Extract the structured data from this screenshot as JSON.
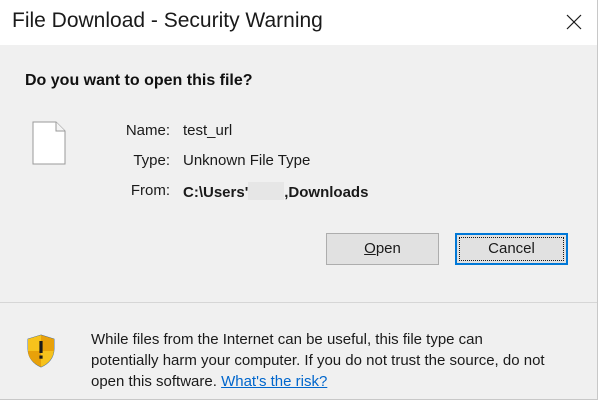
{
  "window": {
    "title": "File Download - Security Warning"
  },
  "prompt": {
    "heading": "Do you want to open this file?"
  },
  "file_info": {
    "name_label": "Name:",
    "name_value": "test_url",
    "type_label": "Type:",
    "type_value": "Unknown File Type",
    "from_label": "From:",
    "from_value_prefix": "C:\\Users'",
    "from_value_suffix": ",Downloads"
  },
  "buttons": {
    "open_label_mnemonic": "O",
    "open_label_rest": "pen",
    "cancel_label": "Cancel"
  },
  "warning": {
    "line1": "While files from the Internet can be useful, this file type can",
    "line2": "potentially harm your computer. If you do not trust the source, do not",
    "line3_text": "open this software. ",
    "link_text": "What's the risk?"
  },
  "icons": {
    "file": "blank-file-icon",
    "shield": "security-shield-warning-icon",
    "close": "close-icon"
  },
  "colors": {
    "link": "#0066cc",
    "focus_border": "#0078d7",
    "shield_yellow": "#f6c21c",
    "shield_blue": "#3a7bd5"
  }
}
